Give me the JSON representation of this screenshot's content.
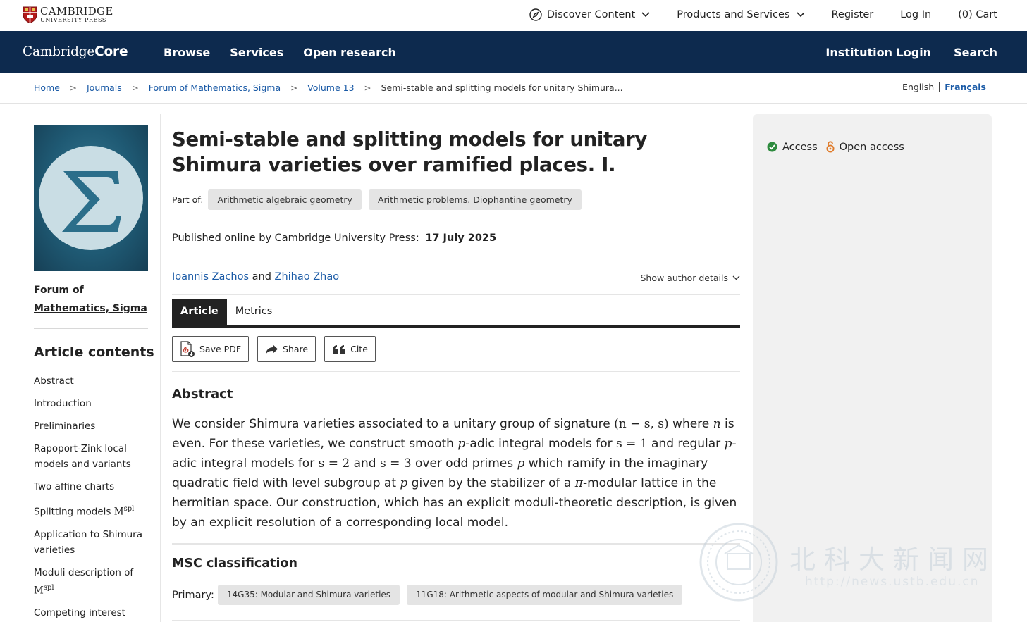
{
  "topbar": {
    "publisher_line1": "CAMBRIDGE",
    "publisher_line2": "UNIVERSITY PRESS",
    "nav": [
      "Discover Content",
      "Products and Services",
      "Register",
      "Log In",
      "(0) Cart"
    ]
  },
  "corebar": {
    "logo_part1": "Cambridge",
    "logo_part2": "Core",
    "nav": [
      "Browse",
      "Services",
      "Open research"
    ],
    "right": [
      "Institution Login",
      "Search"
    ],
    "background": "#0d2a4e"
  },
  "breadcrumb": {
    "items": [
      "Home",
      "Journals",
      "Forum of Mathematics, Sigma",
      "Volume 13"
    ],
    "current": "Semi-stable and splitting models for unitary Shimura...",
    "separator": ">"
  },
  "language": {
    "english": "English",
    "french": "Français"
  },
  "journal": {
    "name": "Forum of Mathematics, Sigma",
    "cover_symbol": "Σ"
  },
  "contents": {
    "title": "Article contents",
    "items": [
      "Abstract",
      "Introduction",
      "Preliminaries",
      "Rapoport-Zink local models and variants",
      "Two affine charts",
      "Splitting models ",
      "Application to Shimura varieties",
      "Moduli description of ",
      "Competing interest"
    ],
    "math_symbol": "M",
    "math_sup": "spl"
  },
  "article": {
    "title": "Semi-stable and splitting models for unitary Shimura varieties over ramified places. I.",
    "part_of_label": "Part of:",
    "part_of": [
      "Arithmetic algebraic geometry",
      "Arithmetic problems. Diophantine geometry"
    ],
    "published_label": "Published online by Cambridge University Press:",
    "published_date": "17 July 2025",
    "authors": [
      "Ioannis Zachos",
      "Zhihao Zhao"
    ],
    "author_join": "and",
    "show_author_details": "Show author details"
  },
  "tabs": [
    "Article",
    "Metrics"
  ],
  "actions": [
    "Save PDF",
    "Share",
    "Cite"
  ],
  "abstract": {
    "title": "Abstract",
    "t1": "We consider Shimura varieties associated to a unitary group of signature ",
    "m1": "(n − s, s)",
    "t2": " where ",
    "m2": "n",
    "t3": " is even. For these varieties, we construct smooth ",
    "m3": "p",
    "t4": "-adic integral models for ",
    "m4": "s = 1",
    "t5": " and regular ",
    "m5": "p",
    "t6": "-adic integral models for ",
    "m6": "s = 2",
    "t7": " and ",
    "m7": "s = 3",
    "t8": " over odd primes ",
    "m8": "p",
    "t9": " which ramify in the imaginary quadratic field with level subgroup at ",
    "m9": "p",
    "t10": " given by the stabilizer of a ",
    "m10": "π",
    "t11": "-modular lattice in the hermitian space. Our construction, which has an explicit moduli-theoretic description, is given by an explicit resolution of a corresponding local model."
  },
  "msc": {
    "title": "MSC classification",
    "primary_label": "Primary:",
    "primary": [
      "14G35: Modular and Shimura varieties",
      "11G18: Arithmetic aspects of modular and Shimura varieties"
    ]
  },
  "sidebar": {
    "access_label": "Access",
    "open_access_label": "Open access"
  },
  "watermark": {
    "text": "北科大新闻网",
    "url": "http://news.ustb.edu.cn"
  },
  "colors": {
    "link": "#1a5aa6",
    "access_green": "#2e8b3e",
    "open_access_orange": "#e07b2a"
  },
  "icons": [
    "compass-icon",
    "chevron-down-icon",
    "pdf-icon",
    "share-icon",
    "quote-icon",
    "check-circle-icon",
    "open-access-lock-icon"
  ]
}
